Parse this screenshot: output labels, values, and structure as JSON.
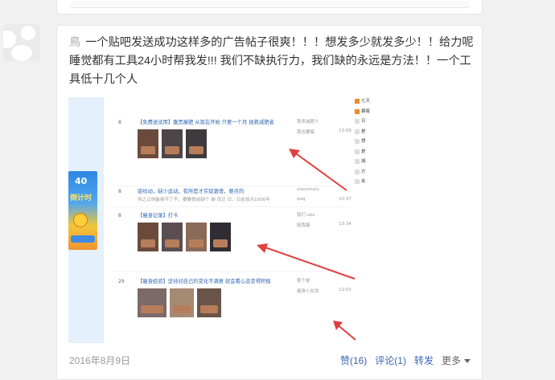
{
  "post": {
    "prefix": "鳥",
    "text": "一个贴吧发送成功这样多的广告帖子很爽！！！想发多少就发多少！！给力呢睡觉都有工具24小时帮我发!!! 我们不缺执行力，我们缺的永远是方法！！一个工具低十几个人",
    "date": "2016年8月9日"
  },
  "actions": {
    "like": "赞(16)",
    "comment": "评论(1)",
    "forward": "转发",
    "more": "更多"
  },
  "screenshot": {
    "ad": {
      "number": "40",
      "text": "倒计时"
    },
    "threads": [
      {
        "num": "8",
        "title": "【免费送试用】腹黑瘦肥 从现在开始 只要一个月 拯救减肥者",
        "meta1": "我来减肥人",
        "meta2": "我也要瘦",
        "time": "13:08"
      },
      {
        "num": "8",
        "title": "驱纹动，缺少运动，有所是才实现激增，要点的",
        "abstract": "持之以恒能够不了不，要要提前缺个 碳 改正 日，日前加点1006年",
        "meta1": "xiaoxinxiu",
        "meta2": "qaq",
        "time": "10:37"
      },
      {
        "num": "8",
        "title": "【瘦身记录】打卡",
        "meta1": "我们 vbs",
        "meta2": "陪我瘦",
        "time": "13:34"
      },
      {
        "num": "29",
        "title": "【瘦身经验】坚持对自己的变化不满意 就会看心态变得积极",
        "meta1": "那个是",
        "meta2": "瘦身小女孩",
        "time": "12:02"
      }
    ],
    "right_list": [
      "七天",
      "暴瘦",
      "日",
      "是",
      "想",
      "是",
      "减",
      "方",
      "友"
    ]
  }
}
